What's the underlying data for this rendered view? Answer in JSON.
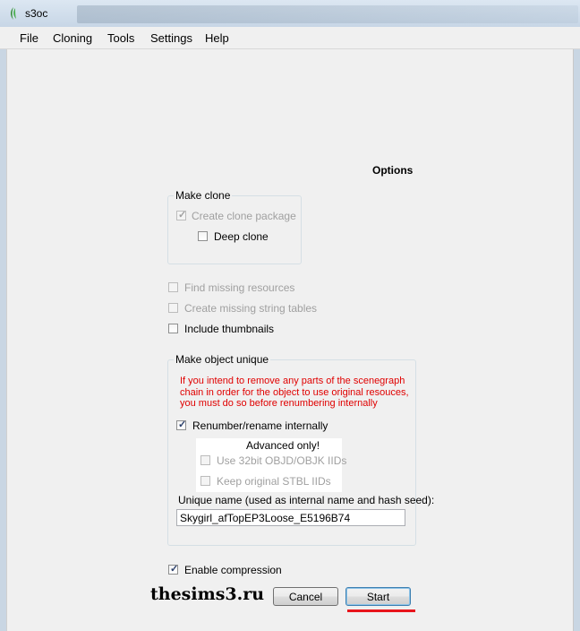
{
  "window": {
    "title": "s3oc"
  },
  "menu": {
    "items": [
      "File",
      "Cloning",
      "Tools",
      "Settings",
      "Help"
    ]
  },
  "options": {
    "title": "Options",
    "make_clone": {
      "group_label": "Make clone",
      "create_clone_package": {
        "label": "Create clone package",
        "checked": true,
        "enabled": false
      },
      "deep_clone": {
        "label": "Deep clone",
        "checked": false,
        "enabled": true
      }
    },
    "find_missing_resources": {
      "label": "Find missing resources",
      "checked": false,
      "enabled": false
    },
    "create_missing_string_tables": {
      "label": "Create missing string tables",
      "checked": false,
      "enabled": false
    },
    "include_thumbnails": {
      "label": "Include thumbnails",
      "checked": false,
      "enabled": true
    },
    "make_unique": {
      "group_label": "Make object unique",
      "warning": "If you intend to remove any parts of the scenegraph chain in order for the object to use original resouces, you must do so before renumbering internally",
      "renumber": {
        "label": "Renumber/rename internally",
        "checked": true,
        "enabled": true
      },
      "advanced": {
        "title": "Advanced only!",
        "use_32bit": {
          "label": "Use 32bit OBJD/OBJK IIDs",
          "checked": false,
          "enabled": false
        },
        "keep_stbl": {
          "label": "Keep original STBL IIDs",
          "checked": false,
          "enabled": false
        }
      },
      "unique_name_label": "Unique name (used as internal name and hash seed):",
      "unique_name_value": "Skygirl_afTopEP3Loose_E5196B74"
    },
    "enable_compression": {
      "label": "Enable compression",
      "checked": true,
      "enabled": true
    }
  },
  "buttons": {
    "cancel": "Cancel",
    "start": "Start"
  },
  "watermark": "thesims3.ru",
  "colors": {
    "warning": "#e00000",
    "highlight_underline": "#e8141c"
  },
  "check_glyph": "✓"
}
